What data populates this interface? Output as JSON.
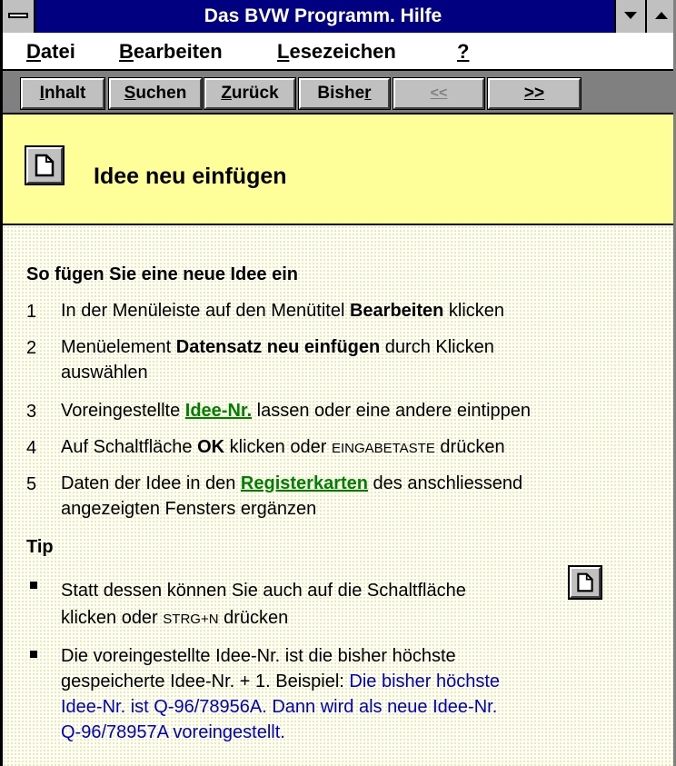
{
  "window": {
    "title": "Das BVW Programm. Hilfe"
  },
  "menu": {
    "file": {
      "key": "D",
      "rest": "atei"
    },
    "edit": {
      "key": "B",
      "rest": "earbeiten"
    },
    "bookmarks": {
      "key": "L",
      "rest": "esezeichen"
    },
    "help": "?"
  },
  "toolbar": {
    "contents": {
      "key": "I",
      "rest": "nhalt"
    },
    "search": {
      "key": "S",
      "rest": "uchen"
    },
    "back": {
      "key": "Z",
      "rest": "urück"
    },
    "history_pre": "Bishe",
    "history_key": "r",
    "prev": "<<",
    "next": ">>"
  },
  "header": {
    "title": "Idee neu einfügen",
    "icon": "new-page-icon"
  },
  "content": {
    "section_title": "So fügen Sie eine neue Idee ein",
    "steps": [
      {
        "n": "1",
        "t1": "In der Menüleiste auf den Menütitel ",
        "b1": "Bearbeiten",
        "t2": " klicken"
      },
      {
        "n": "2",
        "t1": "Menüelement ",
        "b1": "Datensatz neu einfügen",
        "t2": " durch Klicken",
        "l2": "auswählen"
      },
      {
        "n": "3",
        "t1": "Voreingestellte ",
        "link": "Idee-Nr.",
        "t2": " lassen oder eine andere eintippen"
      },
      {
        "n": "4",
        "t1": "Auf Schaltfläche ",
        "b1": "OK",
        "t2": " klicken oder ",
        "sc": "EINGABETASTE",
        "t3": " drücken"
      },
      {
        "n": "5",
        "t1": "Daten der Idee in den ",
        "link": "Registerkarten",
        "t2": " des anschliessend",
        "l2": "angezeigten Fensters ergänzen"
      }
    ],
    "tip_title": "Tip",
    "tips": [
      {
        "l1": "Statt dessen können Sie auch auf die Schaltfläche",
        "l2a": "klicken oder ",
        "sc": "STRG+N",
        "l2b": " drücken"
      },
      {
        "l1": "Die voreingestellte Idee-Nr. ist die bisher höchste",
        "l2a": "gespeicherte Idee-Nr. + 1. Beispiel: ",
        "l2b": "Die bisher höchste",
        "l3": "Idee-Nr. ist Q-96/78956A. Dann wird als neue Idee-Nr.",
        "l4": "Q-96/78957A voreingestellt."
      }
    ]
  },
  "colors": {
    "titlebar": "#000080",
    "header_bg": "#ffff99",
    "link": "#008000",
    "example_text": "#0000c0"
  }
}
